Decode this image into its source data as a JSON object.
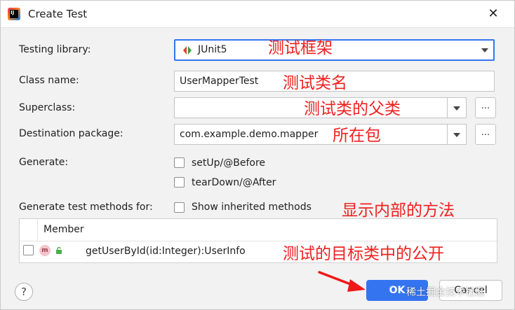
{
  "window": {
    "title": "Create Test",
    "close_glyph": "✕"
  },
  "fields": {
    "testing_library_label": "Testing library:",
    "testing_library_value": "JUnit5",
    "class_name_label": "Class name:",
    "class_name_value": "UserMapperTest",
    "superclass_label": "Superclass:",
    "superclass_value": "",
    "destination_label": "Destination package:",
    "destination_value": "com.example.demo.mapper",
    "ellipsis": "..."
  },
  "generate": {
    "label": "Generate:",
    "setup": "setUp/@Before",
    "teardown": "tearDown/@After"
  },
  "methods": {
    "label": "Generate test methods for:",
    "show_inherited": "Show inherited methods",
    "column_member": "Member",
    "rows": [
      {
        "icon": "m",
        "signature": "getUserById(id:Integer):UserInfo",
        "checked": false
      }
    ]
  },
  "annotations": {
    "testing_library": "测试框架",
    "class_name": "测试类名",
    "superclass": "测试类的父类",
    "destination": "所在包",
    "show_inherited": "显示内部的方法",
    "member": "测试的目标类中的公开"
  },
  "buttons": {
    "help": "?",
    "ok": "OK",
    "cancel": "Cancel"
  },
  "watermark": "稀土掘金技术社区",
  "colors": {
    "accent": "#3574f0",
    "annotation": "#f02020"
  },
  "icons": {
    "app": "intellij-icon",
    "junit": "junit-icon",
    "method": "method-icon",
    "lock": "lock-icon",
    "help": "help-icon",
    "arrow": "red-arrow-icon"
  }
}
